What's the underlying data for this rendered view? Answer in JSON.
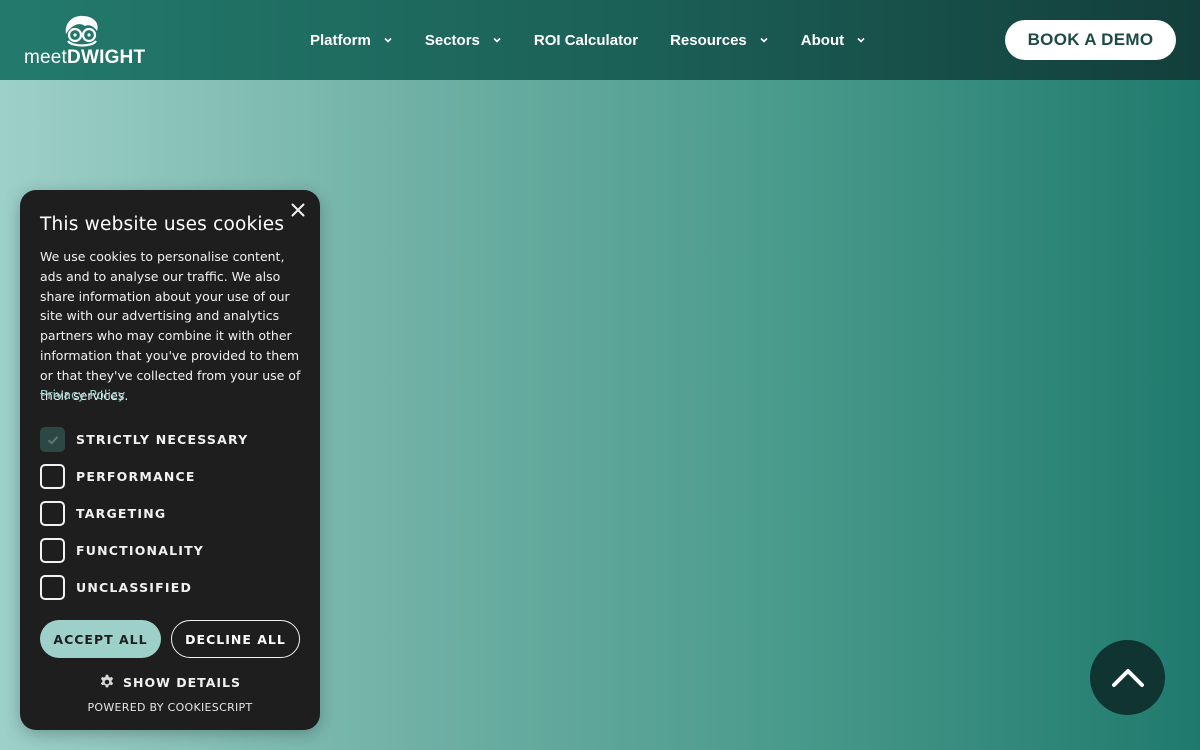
{
  "header": {
    "logo": {
      "prefix": "meet",
      "brand": "DWIGHT",
      "icon": "dwight-face-icon"
    },
    "nav": [
      {
        "label": "Platform",
        "has_dropdown": true
      },
      {
        "label": "Sectors",
        "has_dropdown": true
      },
      {
        "label": "ROI Calculator",
        "has_dropdown": false
      },
      {
        "label": "Resources",
        "has_dropdown": true
      },
      {
        "label": "About",
        "has_dropdown": true
      }
    ],
    "cta_label": "BOOK A DEMO"
  },
  "cookie_banner": {
    "title": "This website uses cookies",
    "body": "We use cookies to personalise content, ads and to analyse our traffic. We also share information about your use of our site with our advertising and analytics partners who may combine it with other information that you've provided to them or that they've collected from your use of their services.",
    "privacy_link": "Privacy Policy",
    "options": [
      {
        "label": "STRICTLY NECESSARY",
        "checked": true
      },
      {
        "label": "PERFORMANCE",
        "checked": false
      },
      {
        "label": "TARGETING",
        "checked": false
      },
      {
        "label": "FUNCTIONALITY",
        "checked": false
      },
      {
        "label": "UNCLASSIFIED",
        "checked": false
      }
    ],
    "accept_label": "ACCEPT ALL",
    "decline_label": "DECLINE ALL",
    "show_details_label": "SHOW DETAILS",
    "powered_by": "POWERED BY COOKIESCRIPT"
  },
  "colors": {
    "header_start": "#237a6c",
    "header_end": "#133e3b",
    "accent": "#9dd0c9",
    "panel": "#1e1e1e",
    "scroll_button": "#0f3431"
  },
  "icons": {
    "close": "close-icon",
    "gear": "gear-icon",
    "scroll_top": "chevron-up-icon",
    "nav_dropdown": "chevron-down-icon",
    "checkmark": "checkmark-icon"
  }
}
